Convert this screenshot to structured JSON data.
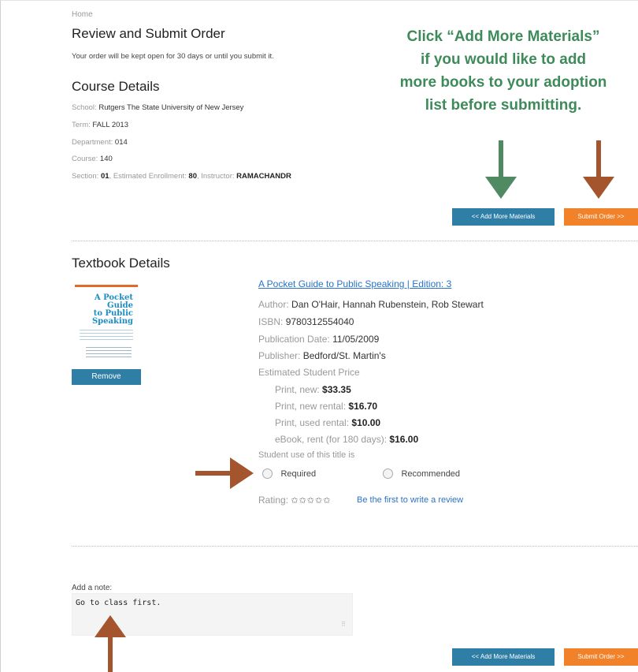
{
  "breadcrumb": "Home",
  "page_title": "Review and Submit Order",
  "order_notice": "Your order will be kept open for 30 days or until you submit it.",
  "course_details": {
    "heading": "Course Details",
    "school_label": "School:",
    "school": "Rutgers The State University of New Jersey",
    "term_label": "Term:",
    "term": "FALL 2013",
    "department_label": "Department:",
    "department": "014",
    "course_label": "Course:",
    "course": "140",
    "section_label": "Section:",
    "section": "01",
    "enrollment_label": ", Estimated Enrollment:",
    "enrollment": "80",
    "instructor_label": ", Instructor:",
    "instructor": "RAMACHANDR"
  },
  "callout": {
    "line1": "Click “Add More Materials”",
    "line2": "if you would like to add",
    "line3": "more books to your adoption",
    "line4": "list before submitting."
  },
  "buttons": {
    "add_more": "<< Add More Materials",
    "submit": "Submit Order >>",
    "remove": "Remove"
  },
  "textbook": {
    "heading": "Textbook Details",
    "title_link": "A Pocket Guide to Public Speaking | Edition: 3",
    "author_label": "Author:",
    "author": "Dan O'Hair, Hannah Rubenstein, Rob Stewart",
    "isbn_label": "ISBN:",
    "isbn": "9780312554040",
    "pubdate_label": "Publication Date:",
    "pubdate": "11/05/2009",
    "publisher_label": "Publisher:",
    "publisher": "Bedford/St. Martin's",
    "price_heading": "Estimated Student Price",
    "prices": [
      {
        "label": "Print, new:",
        "value": "$33.35"
      },
      {
        "label": "Print, new rental:",
        "value": "$16.70"
      },
      {
        "label": "Print, used rental:",
        "value": "$10.00"
      },
      {
        "label": "eBook, rent (for 180 days):",
        "value": "$16.00"
      }
    ],
    "use_label": "Student use of this title is",
    "option_required": "Required",
    "option_recommended": "Recommended",
    "rating_label": "Rating:",
    "stars": "✩✩✩✩✩",
    "review_link": "Be the first to write a review",
    "cover": {
      "line1": "A Pocket",
      "line2": "Guide",
      "line3": "to Public",
      "line4": "Speaking"
    }
  },
  "note": {
    "label": "Add a note:",
    "value": "Go to class first."
  },
  "colors": {
    "green_arrow": "#4f8a63",
    "brown_arrow": "#a5552d",
    "add_button": "#2f7ea6",
    "submit_button": "#f1822a",
    "callout_text": "#3f8a5a"
  }
}
